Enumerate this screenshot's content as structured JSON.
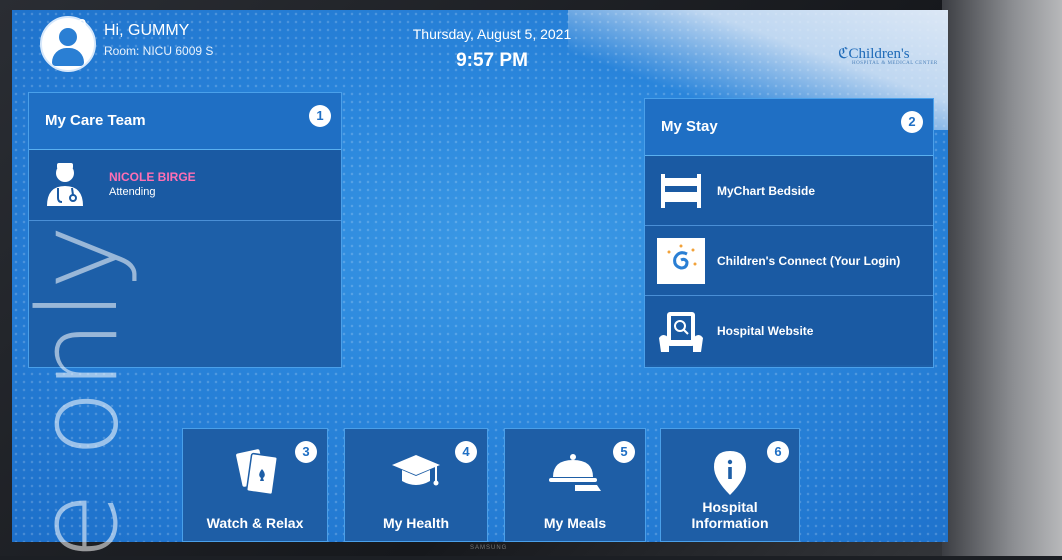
{
  "header": {
    "user_badge": "0",
    "greeting": "Hi, GUMMY",
    "room": "Room: NICU 6009 S",
    "date": "Thursday, August 5, 2021",
    "time": "9:57 PM",
    "logo": "Children's",
    "logo_sub": "HOSPITAL & MEDICAL CENTER"
  },
  "care_team": {
    "title": "My Care Team",
    "number": "1",
    "members": [
      {
        "name": "NICOLE BIRGE",
        "role": "Attending"
      }
    ]
  },
  "my_stay": {
    "title": "My Stay",
    "number": "2",
    "items": [
      {
        "label": "MyChart Bedside",
        "icon": "bed-icon"
      },
      {
        "label": "Children's Connect (Your Login)",
        "icon": "children-connect-icon"
      },
      {
        "label": "Hospital Website",
        "icon": "tablet-search-icon"
      }
    ]
  },
  "tiles": [
    {
      "label": "Watch & Relax",
      "number": "3",
      "icon": "playing-cards-icon"
    },
    {
      "label": "My Health",
      "number": "4",
      "icon": "graduation-cap-icon"
    },
    {
      "label": "My Meals",
      "number": "5",
      "icon": "serving-cloche-icon"
    },
    {
      "label": "Hospital Information",
      "number": "6",
      "icon": "info-pin-icon"
    }
  ],
  "watermark": "e only",
  "brand": "SAMSUNG",
  "colors": {
    "accent": "#1f6fc4",
    "panel": "#1d5fa8",
    "name_highlight": "#ff6fb3"
  }
}
